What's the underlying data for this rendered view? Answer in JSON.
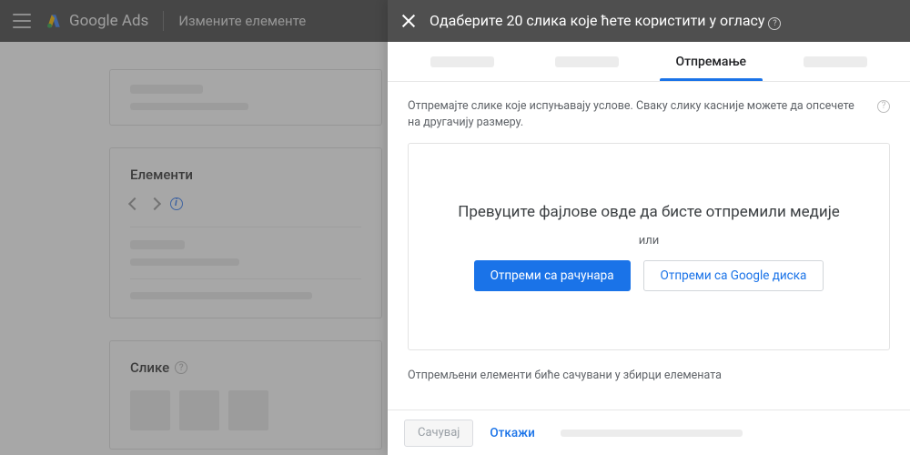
{
  "header": {
    "product": "Google Ads",
    "subtitle": "Измените елементе"
  },
  "bg": {
    "section_elements": "Елементи",
    "section_images": "Слике"
  },
  "modal": {
    "title": "Одаберите 20 слика које ћете користити у огласу",
    "tabs": {
      "upload": "Отпремање"
    },
    "hint": "Отпремајте слике које испуњавају услове. Сваку слику касније можете да опсечете на другачију размеру.",
    "drop_title": "Превуците фајлове овде да бисте отпремили медије",
    "drop_or": "или",
    "btn_upload_pc": "Отпреми са рачунара",
    "btn_upload_drive": "Отпреми са Google диска",
    "note": "Отпремљени елементи биће сачувани у збирци елемената",
    "footer_save": "Сачувај",
    "footer_cancel": "Откажи"
  }
}
